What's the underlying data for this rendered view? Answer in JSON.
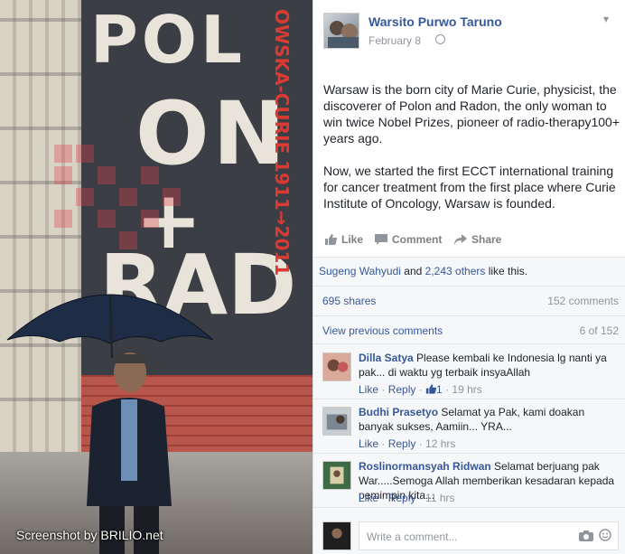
{
  "photo": {
    "mural_lines": [
      "POL",
      "ON",
      "+",
      "RAD"
    ],
    "mural_vertical": "OWSKA-CURIE 1911→2011",
    "caption": "Screenshot by BRILIO.net"
  },
  "watermark": {
    "text": "BRILIO",
    "suffix": ".NET"
  },
  "post": {
    "author": "Warsito Purwo Taruno",
    "date": "February 8",
    "paragraphs": [
      "Warsaw is the born city of Marie Curie, physicist, the discoverer of Polon and Radon, the only woman to win twice Nobel Prizes, pioneer of radio-therapy100+ years ago.",
      "Now, we started the first ECCT international training for cancer treatment from the first place where Curie Institute of Oncology, Warsaw is founded."
    ],
    "actions": {
      "like": "Like",
      "comment": "Comment",
      "share": "Share"
    },
    "likes": {
      "first_name": "Sugeng Wahyudi",
      "connector": " and ",
      "others": "2,243 others",
      "suffix": " like this."
    },
    "shares": "695 shares",
    "comment_count": "152 comments",
    "view_previous": "View previous comments",
    "shown_count": "6 of 152",
    "comments": [
      {
        "name": "Dilla Satya",
        "text": "Please kembali ke Indonesia lg nanti ya pak... di waktu yg terbaik insyaAllah",
        "like": "Like",
        "reply": "Reply",
        "likes": "1",
        "time": "19 hrs"
      },
      {
        "name": "Budhi Prasetyo",
        "text": "Selamat ya Pak, kami doakan banyak sukses, Aamiin... YRA...",
        "like": "Like",
        "reply": "Reply",
        "likes": "",
        "time": "12 hrs"
      },
      {
        "name": "Roslinormansyah Ridwan",
        "text": "Selamat berjuang pak War.....Semoga Allah memberikan kesadaran kepada pemimpin kita...",
        "like": "Like",
        "reply": "Reply",
        "likes": "",
        "time": "11 hrs"
      }
    ],
    "composer_placeholder": "Write a comment..."
  },
  "colors": {
    "link": "#365899",
    "muted": "#90949c",
    "mural_red": "#d93b33",
    "watermark_red": "#e0424c"
  }
}
